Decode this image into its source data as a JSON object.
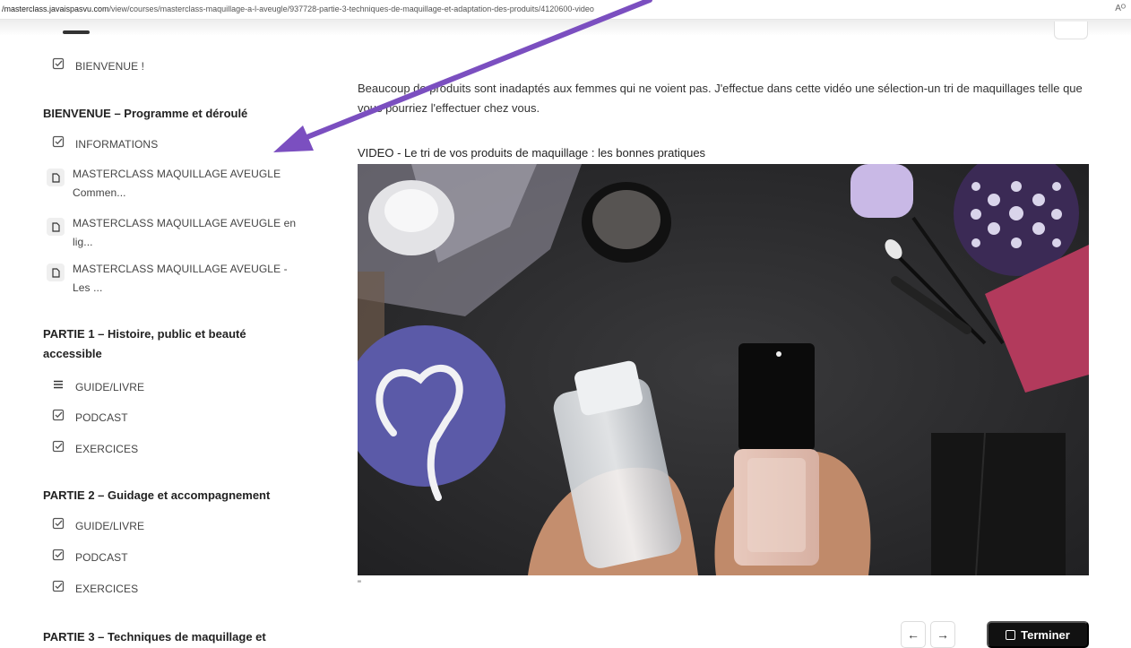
{
  "browser": {
    "url_host": "/masterclass.javaispasvu.com",
    "url_path": "/view/courses/masterclass-maquillage-a-l-aveugle/937728-partie-3-techniques-de-maquillage-et-adaptation-des-produits/4120600-video",
    "reader_icon": "Aᴼ"
  },
  "sidebar": {
    "welcome": {
      "label": "BIENVENUE !",
      "icon": "check-square-icon"
    },
    "section1": {
      "title": "BIENVENUE – Programme et déroulé",
      "items": [
        {
          "label": "INFORMATIONS",
          "icon": "check-square-icon"
        },
        {
          "label": "MASTERCLASS MAQUILLAGE AVEUGLE Commen...",
          "icon": "document-icon"
        },
        {
          "label": "MASTERCLASS MAQUILLAGE AVEUGLE en lig...",
          "icon": "document-icon"
        },
        {
          "label": "MASTERCLASS MAQUILLAGE AVEUGLE - Les ...",
          "icon": "document-icon"
        }
      ]
    },
    "section2": {
      "title": "PARTIE 1 – Histoire, public et beauté accessible",
      "items": [
        {
          "label": "GUIDE/LIVRE",
          "icon": "list-icon"
        },
        {
          "label": "PODCAST",
          "icon": "check-square-icon"
        },
        {
          "label": "EXERCICES",
          "icon": "check-square-icon"
        }
      ]
    },
    "section3": {
      "title": "PARTIE 2 – Guidage et accompagnement",
      "items": [
        {
          "label": "GUIDE/LIVRE",
          "icon": "check-square-icon"
        },
        {
          "label": "PODCAST",
          "icon": "check-square-icon"
        },
        {
          "label": "EXERCICES",
          "icon": "check-square-icon"
        }
      ]
    },
    "section4": {
      "title": "PARTIE 3 – Techniques de maquillage et"
    }
  },
  "main": {
    "description": "Beaucoup de produits sont inadaptés aux femmes qui ne voient pas. J'effectue dans cette vidéo une sélection-un tri de maquillages telle que vous pourriez l'effectuer chez vous.",
    "video_title": "VIDEO - Le tri de vos produits de maquillage : les bonnes pratiques",
    "stray_quote": "\"",
    "prev_label": "←",
    "next_label": "→",
    "finish_label": "Terminer"
  },
  "colors": {
    "annotation_arrow": "#7b4fc0",
    "primary_button": "#111111"
  }
}
